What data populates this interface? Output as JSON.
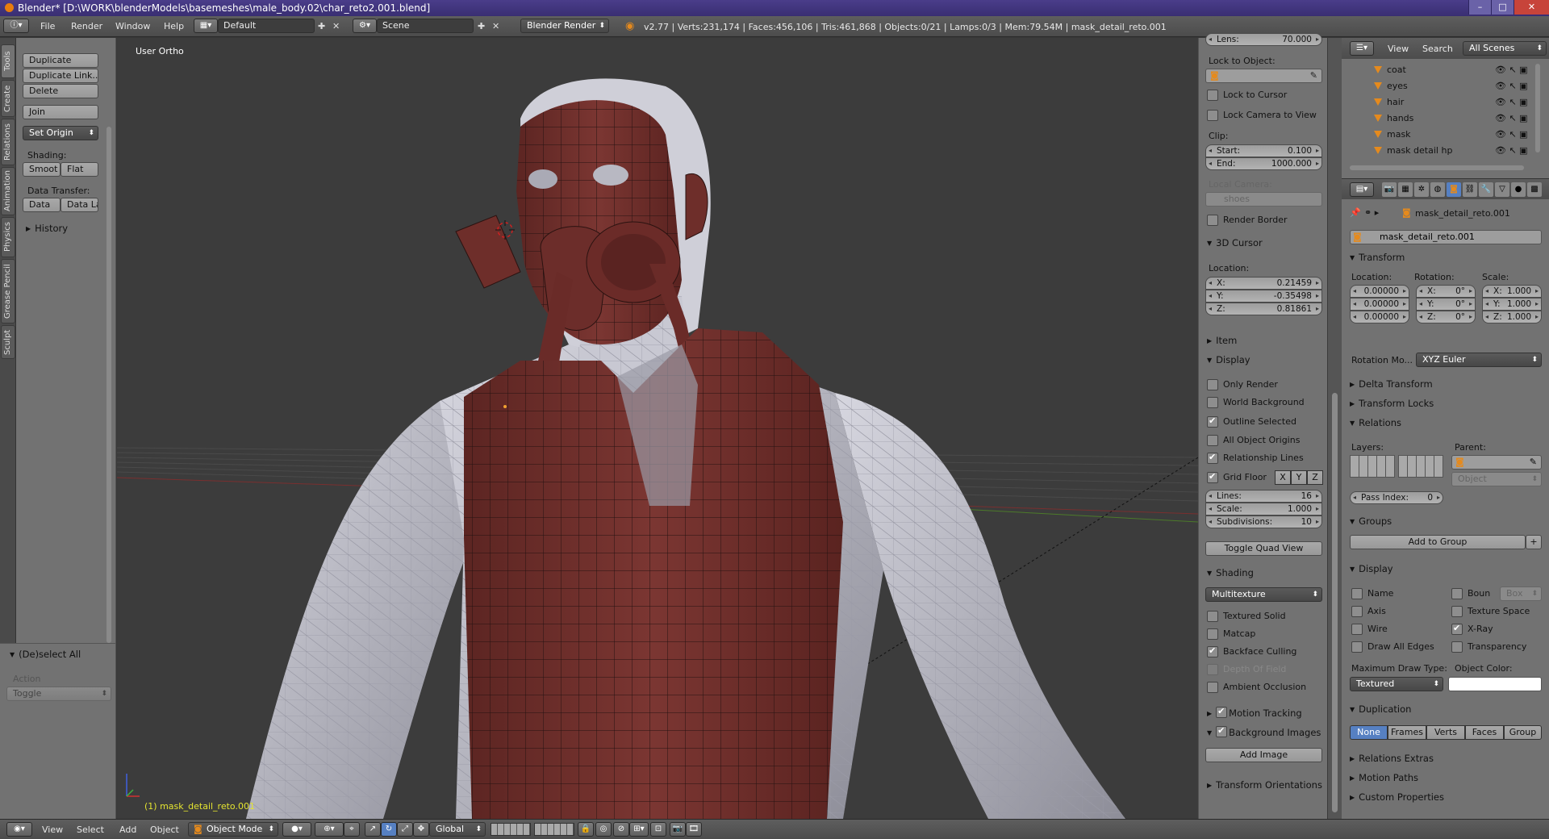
{
  "title_bar": {
    "text": "Blender* [D:\\WORK\\blenderModels\\basemeshes\\male_body.02\\char_reto2.001.blend]"
  },
  "info_header": {
    "menus": [
      "File",
      "Render",
      "Window",
      "Help"
    ],
    "screen_layout": "Default",
    "scene": "Scene",
    "render_engine": "Blender Render",
    "stats": "v2.77 | Verts:231,174 | Faces:456,106 | Tris:461,868 | Objects:0/21 | Lamps:0/3 | Mem:79.54M | mask_detail_reto.001"
  },
  "side_tabs": [
    "Tools",
    "Create",
    "Relations",
    "Animation",
    "Physics",
    "Grease Pencil",
    "Sculpt"
  ],
  "tool_shelf": {
    "buttons": [
      "Duplicate",
      "Duplicate Link...",
      "Delete",
      "Join"
    ],
    "set_origin": "Set Origin",
    "shading_label": "Shading:",
    "shading_buttons": [
      "Smoot",
      "Flat"
    ],
    "data_transfer_label": "Data Transfer:",
    "data_buttons": [
      "Data",
      "Data La"
    ],
    "history": "History"
  },
  "redo_panel": {
    "title": "(De)select All",
    "action_label": "Action",
    "action_value": "Toggle"
  },
  "viewport": {
    "view_label": "User Ortho",
    "object_label": "(1) mask_detail_reto.001"
  },
  "n_panel": {
    "lens_label": "Lens:",
    "lens_value": "70.000",
    "lock_to_object": "Lock to Object:",
    "lock_to_cursor": "Lock to Cursor",
    "lock_camera": "Lock Camera to View",
    "clip_label": "Clip:",
    "clip_start_label": "Start:",
    "clip_start": "0.100",
    "clip_end_label": "End:",
    "clip_end": "1000.000",
    "local_camera": "Local Camera:",
    "local_camera_value": "shoes",
    "render_border": "Render Border",
    "cursor_header": "3D Cursor",
    "location_label": "Location:",
    "cursor": {
      "x_label": "X:",
      "x": "0.21459",
      "y_label": "Y:",
      "y": "-0.35498",
      "z_label": "Z:",
      "z": "0.81861"
    },
    "item_header": "Item",
    "display_header": "Display",
    "display_checks": [
      {
        "label": "Only Render",
        "on": false
      },
      {
        "label": "World Background",
        "on": false
      },
      {
        "label": "Outline Selected",
        "on": true
      },
      {
        "label": "All Object Origins",
        "on": false
      },
      {
        "label": "Relationship Lines",
        "on": true
      }
    ],
    "grid_floor": "Grid Floor",
    "axes": [
      "X",
      "Y",
      "Z"
    ],
    "lines_label": "Lines:",
    "lines": "16",
    "scale_label": "Scale:",
    "scale": "1.000",
    "subdiv_label": "Subdivisions:",
    "subdiv": "10",
    "toggle_quad": "Toggle Quad View",
    "shading_header": "Shading",
    "shading_mode": "Multitexture",
    "shading_checks": [
      {
        "label": "Textured Solid",
        "on": false
      },
      {
        "label": "Matcap",
        "on": false
      },
      {
        "label": "Backface Culling",
        "on": true
      },
      {
        "label": "Depth Of Field",
        "on": false,
        "disabled": true
      },
      {
        "label": "Ambient Occlusion",
        "on": false
      }
    ],
    "motion_tracking": "Motion Tracking",
    "background_images": "Background Images",
    "add_image": "Add Image",
    "transform_orientations": "Transform Orientations"
  },
  "outliner": {
    "view": "View",
    "search": "Search",
    "scenes": "All Scenes",
    "items": [
      "coat",
      "eyes",
      "hair",
      "hands",
      "mask",
      "mask detail hp"
    ]
  },
  "properties": {
    "breadcrumb": "mask_detail_reto.001",
    "object_name": "mask_detail_reto.001",
    "transform_header": "Transform",
    "location_label": "Location:",
    "rotation_label": "Rotation:",
    "scale_label": "Scale:",
    "location": [
      "0.00000",
      "0.00000",
      "0.00000"
    ],
    "rotation": [
      {
        "k": "X:",
        "v": "0°"
      },
      {
        "k": "Y:",
        "v": "0°"
      },
      {
        "k": "Z:",
        "v": "0°"
      }
    ],
    "scale": [
      {
        "k": "X:",
        "v": "1.000"
      },
      {
        "k": "Y:",
        "v": "1.000"
      },
      {
        "k": "Z:",
        "v": "1.000"
      }
    ],
    "rotation_mode_label": "Rotation Mo...",
    "rotation_mode": "XYZ Euler",
    "delta_transform": "Delta Transform",
    "transform_locks": "Transform Locks",
    "relations_header": "Relations",
    "layers_label": "Layers:",
    "parent_label": "Parent:",
    "parent_type": "Object",
    "pass_index_label": "Pass Index:",
    "pass_index": "0",
    "groups_header": "Groups",
    "add_to_group": "Add to Group",
    "display_header": "Display",
    "display_left": [
      {
        "label": "Name",
        "on": false
      },
      {
        "label": "Axis",
        "on": false
      },
      {
        "label": "Wire",
        "on": false
      },
      {
        "label": "Draw All Edges",
        "on": false
      }
    ],
    "display_right": [
      {
        "label": "Boun",
        "on": false
      },
      {
        "label": "Texture Space",
        "on": false
      },
      {
        "label": "X-Ray",
        "on": true
      },
      {
        "label": "Transparency",
        "on": false
      }
    ],
    "bounds_type": "Box",
    "max_draw_label": "Maximum Draw Type:",
    "max_draw": "Textured",
    "object_color_label": "Object Color:",
    "object_color": "#ffffff",
    "duplication_header": "Duplication",
    "duplication_tabs": [
      "None",
      "Frames",
      "Verts",
      "Faces",
      "Group"
    ],
    "relations_extras": "Relations Extras",
    "motion_paths": "Motion Paths",
    "custom_properties": "Custom Properties"
  },
  "bottom_bar": {
    "menus": [
      "View",
      "Select",
      "Add",
      "Object"
    ],
    "mode": "Object Mode",
    "orientation": "Global"
  },
  "colors": {
    "title": "#3b2f78",
    "accent_orange": "#e58a1d",
    "selected_blue": "#5680c2",
    "mesh_red": "#6e2e2a",
    "mesh_white": "#c8c8d0"
  }
}
